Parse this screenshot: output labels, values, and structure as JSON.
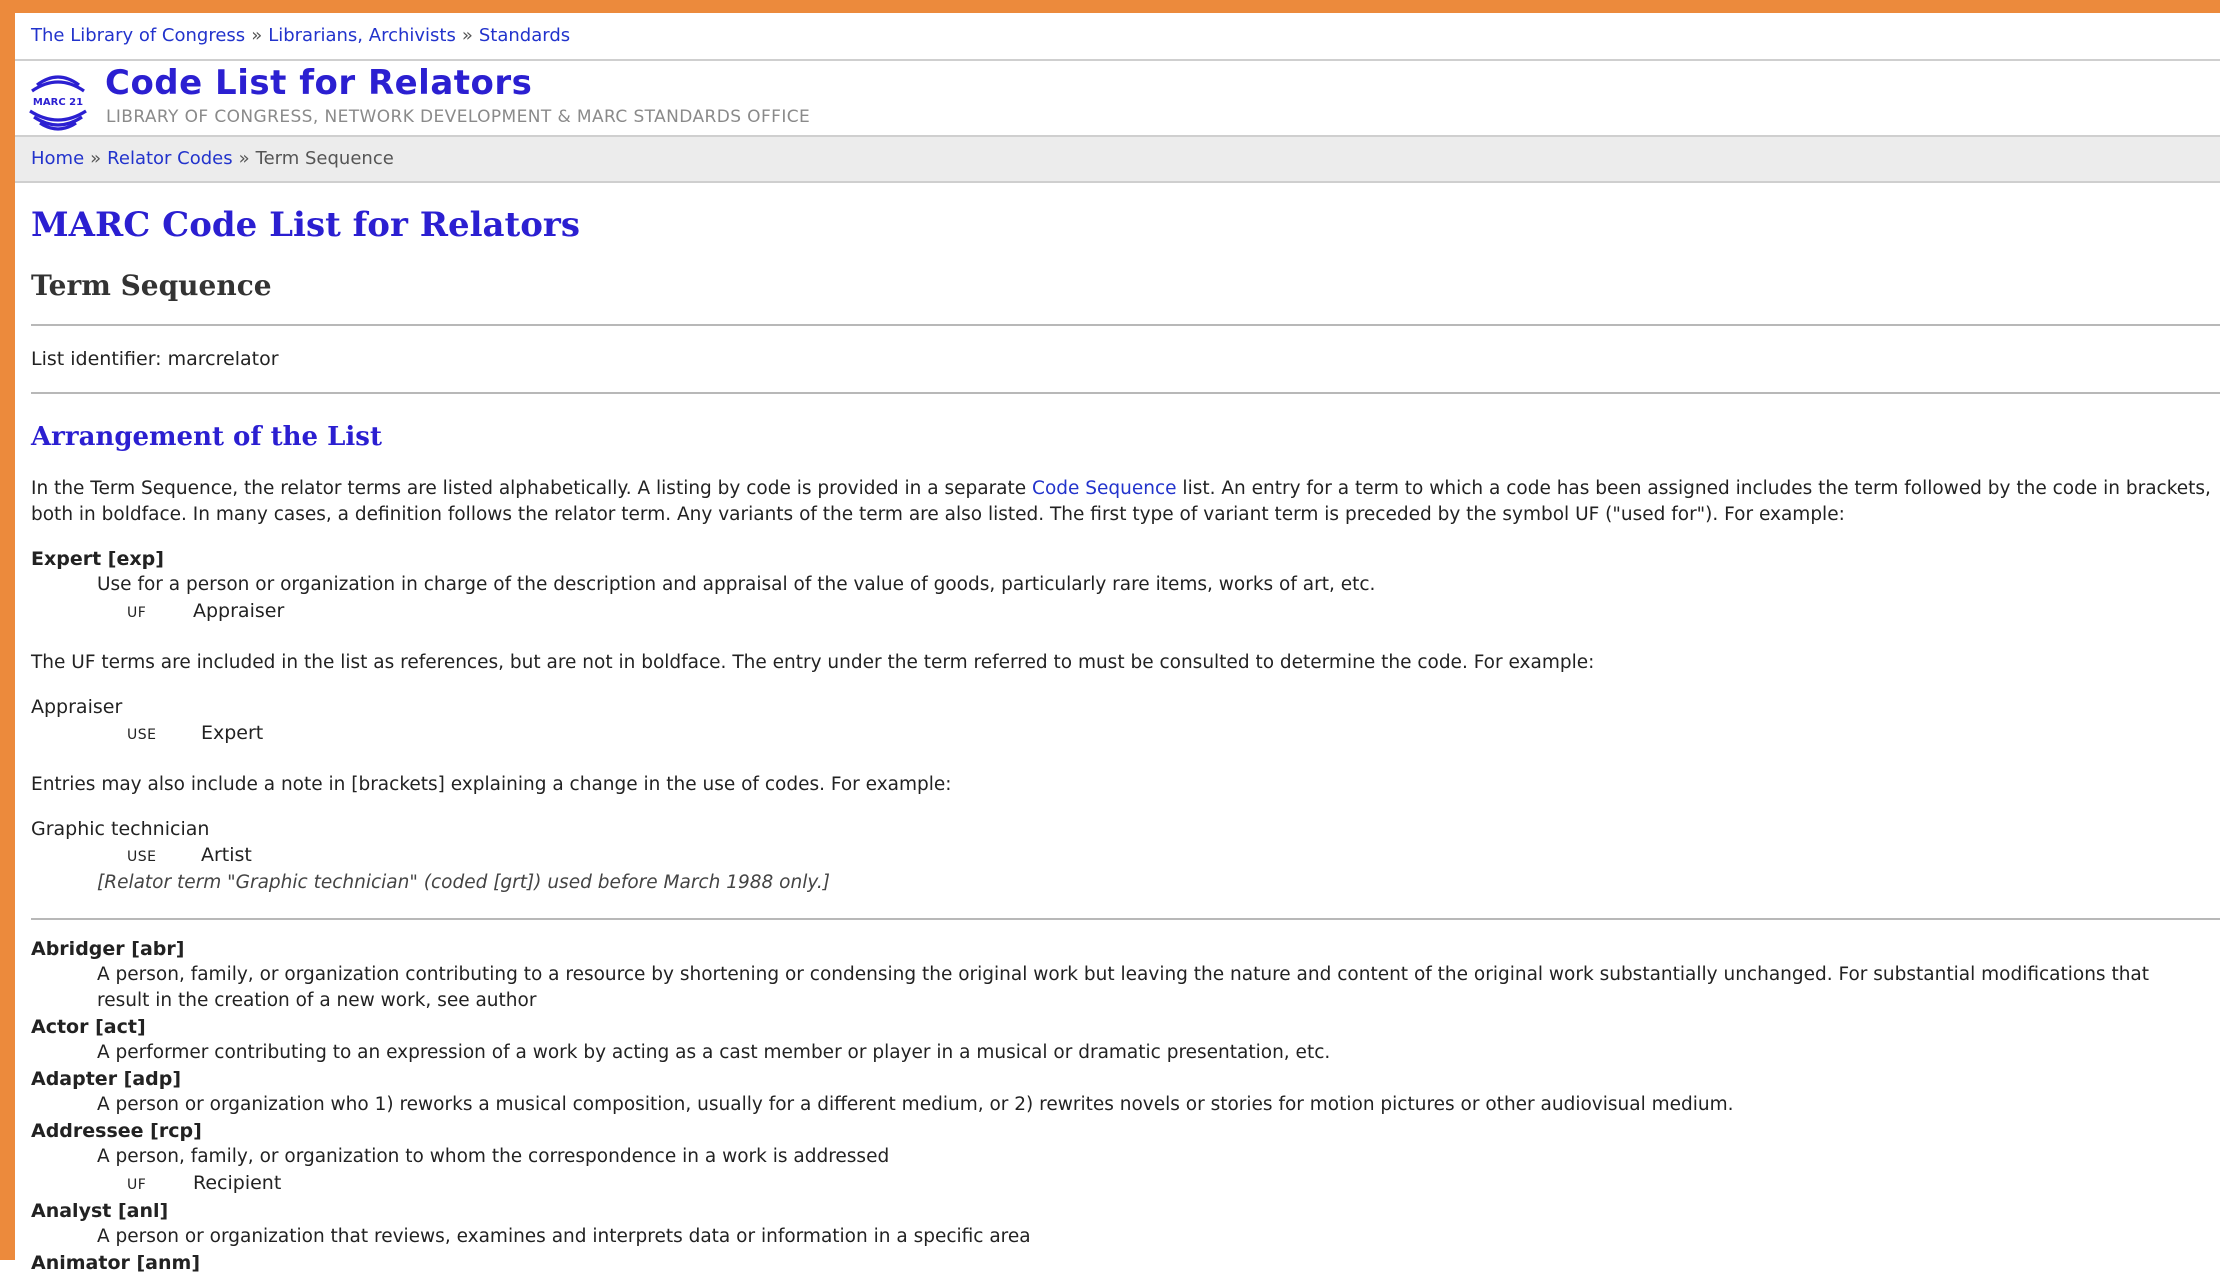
{
  "top_breadcrumb": [
    "The Library of Congress",
    "Librarians, Archivists",
    "Standards"
  ],
  "breadcrumb_separator": "»",
  "site": {
    "logo_text": "MARC 21",
    "title": "Code List for Relators",
    "subtitle": "LIBRARY OF CONGRESS, NETWORK DEVELOPMENT & MARC STANDARDS OFFICE"
  },
  "breadcrumb": {
    "home": "Home",
    "relator_codes": "Relator Codes",
    "current": "Term Sequence"
  },
  "main_title": "MARC Code List for Relators",
  "sub_title": "Term Sequence",
  "list_identifier": "List identifier: marcrelator",
  "section_title": "Arrangement of the List",
  "intro": {
    "before_link": "In the Term Sequence, the relator terms are listed alphabetically. A listing by code is provided in a separate ",
    "link": "Code Sequence",
    "after_link": " list. An entry for a term to which a code has been assigned includes the term followed by the code in brackets, both in boldface. In many cases, a definition follows the relator term. Any variants of the term are also listed. The first type of variant term is preceded by the symbol UF (\"used for\"). For example:"
  },
  "example1": {
    "term": "Expert [exp]",
    "definition": "Use for a person or organization in charge of the description and appraisal of the value of goods, particularly rare items, works of art, etc.",
    "uf_label": "UF",
    "uf_value": "Appraiser"
  },
  "para_uf": "The UF terms are included in the list as references, but are not in boldface. The entry under the term referred to must be consulted to determine the code. For example:",
  "example2": {
    "term": "Appraiser",
    "use_label": "USE",
    "use_value": "Expert"
  },
  "para_brackets": "Entries may also include a note in [brackets] explaining a change in the use of codes. For example:",
  "example3": {
    "term": "Graphic technician",
    "use_label": "USE",
    "use_value": "Artist",
    "note": "[Relator term \"Graphic technician\" (coded [grt]) used before March 1988 only.]"
  },
  "entries": [
    {
      "term": "Abridger [abr]",
      "definition": "A person, family, or organization contributing to a resource by shortening or condensing the original work but leaving the nature and content of the original work substantially unchanged. For substantial modifications that result in the creation of a new work, see author"
    },
    {
      "term": "Actor [act]",
      "definition": "A performer contributing to an expression of a work by acting as a cast member or player in a musical or dramatic presentation, etc."
    },
    {
      "term": "Adapter [adp]",
      "definition": "A person or organization who 1) reworks a musical composition, usually for a different medium, or 2) rewrites novels or stories for motion pictures or other audiovisual medium."
    },
    {
      "term": "Addressee [rcp]",
      "definition": "A person, family, or organization to whom the correspondence in a work is addressed",
      "uf_label": "UF",
      "uf_value": "Recipient"
    },
    {
      "term": "Analyst [anl]",
      "definition": "A person or organization that reviews, examines and interprets data or information in a specific area"
    },
    {
      "term": "Animator [anm]"
    }
  ],
  "colors": {
    "frame": "#ec8a3c",
    "link": "#2233cc",
    "heading": "#2b1fd1"
  }
}
